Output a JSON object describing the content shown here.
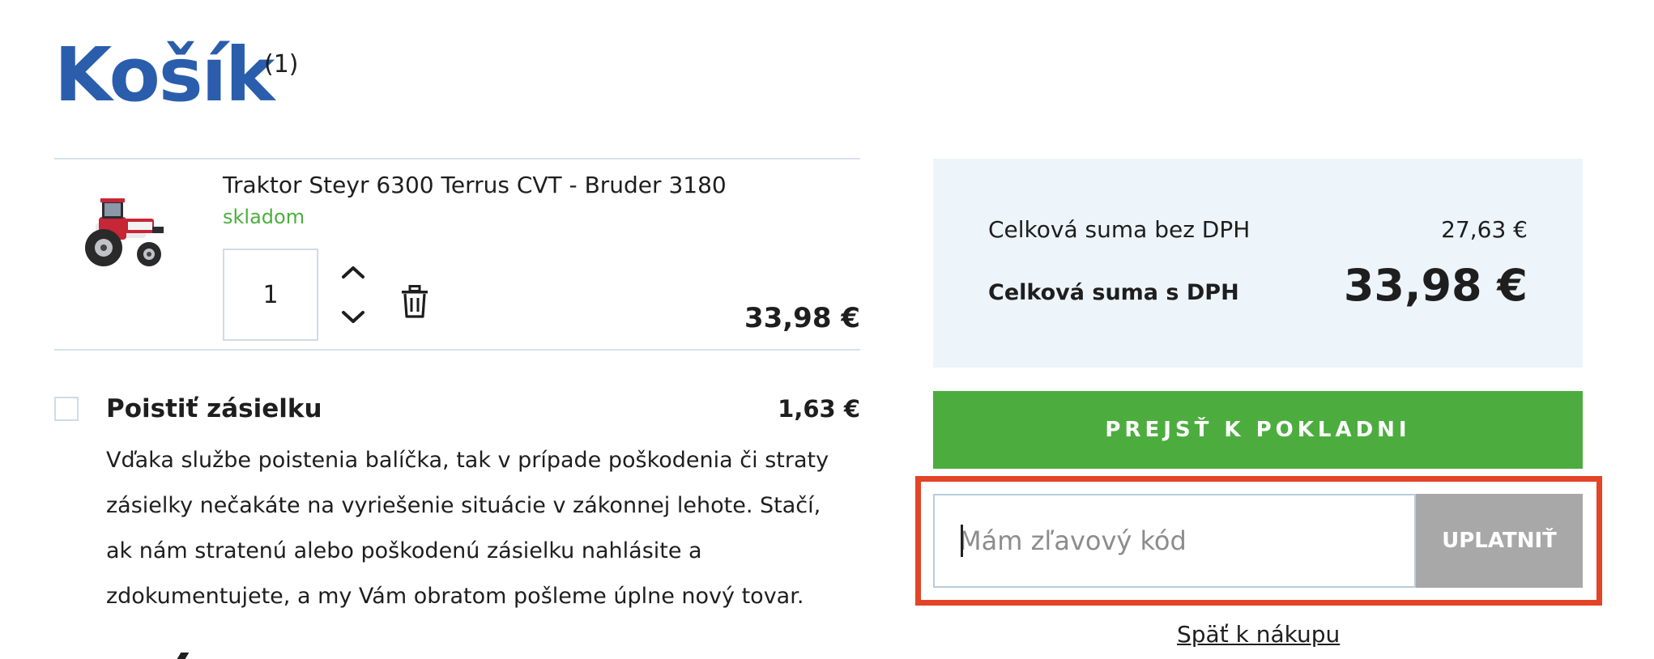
{
  "page": {
    "title": "Košík",
    "count": "(1)"
  },
  "cart": {
    "items": [
      {
        "name": "Traktor Steyr 6300 Terrus CVT - Bruder 3180",
        "stock": "skladom",
        "quantity": "1",
        "price": "33,98 €",
        "image_icon": "red-tractor-image"
      }
    ]
  },
  "insurance": {
    "title": "Poistiť zásielku",
    "price": "1,63 €",
    "checked": false,
    "description_lines": [
      "Vďaka službe poistenia balíčka, tak v prípade poškodenia či straty",
      "zásielky nečakáte na vyriešenie situácie v zákonnej lehote. Stačí,",
      "ak nám stratenú alebo poškodenú zásielku nahlásite a",
      "zdokumentujete, a my Vám obratom pošleme úplne nový tovar."
    ]
  },
  "summary": {
    "net_label": "Celková suma bez DPH",
    "net_value": "27,63 €",
    "gross_label": "Celková suma s DPH",
    "gross_value": "33,98 €"
  },
  "actions": {
    "checkout_label": "PREJSŤ K POKLADNI",
    "coupon_placeholder": "Mám zľavový kód",
    "coupon_value": "",
    "apply_label": "UPLATNIŤ",
    "back_link": "Späť k nákupu"
  },
  "colors": {
    "title_blue": "#2a5eac",
    "stock_green": "#4caf3f",
    "checkout_green": "#4cad3e",
    "summary_bg": "#edf4fa",
    "apply_gray": "#a8a8a8",
    "highlight_red": "#e34327"
  }
}
